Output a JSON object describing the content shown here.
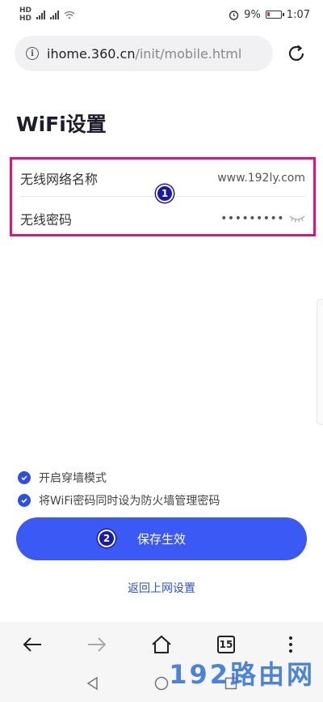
{
  "status_bar": {
    "left_icons": [
      "hd-icon",
      "signal-4g-icon",
      "signal-icon",
      "wifi-icon"
    ],
    "battery_percent": "9%",
    "time": "1:07"
  },
  "url_bar": {
    "host": "ihome.360.cn",
    "path": "/init/mobile.html"
  },
  "page": {
    "title": "WiFi设置"
  },
  "form": {
    "ssid_label": "无线网络名称",
    "ssid_value": "www.192ly.com",
    "password_label": "无线密码",
    "password_value": "•••••••••"
  },
  "badges": {
    "form_badge": "1",
    "button_badge": "2"
  },
  "options": {
    "opt1_label": "开启穿墙模式",
    "opt1_checked": true,
    "opt2_label": "将WiFi密码同时设为防火墙管理密码",
    "opt2_checked": true
  },
  "actions": {
    "save_label": "保存生效",
    "back_label": "返回上网设置"
  },
  "toolbar": {
    "tabs_count": "15"
  },
  "watermark": "192路由网",
  "colors": {
    "accent": "#3b59f5",
    "highlight_border": "#e0147d",
    "badge": "#1a1aa8"
  }
}
